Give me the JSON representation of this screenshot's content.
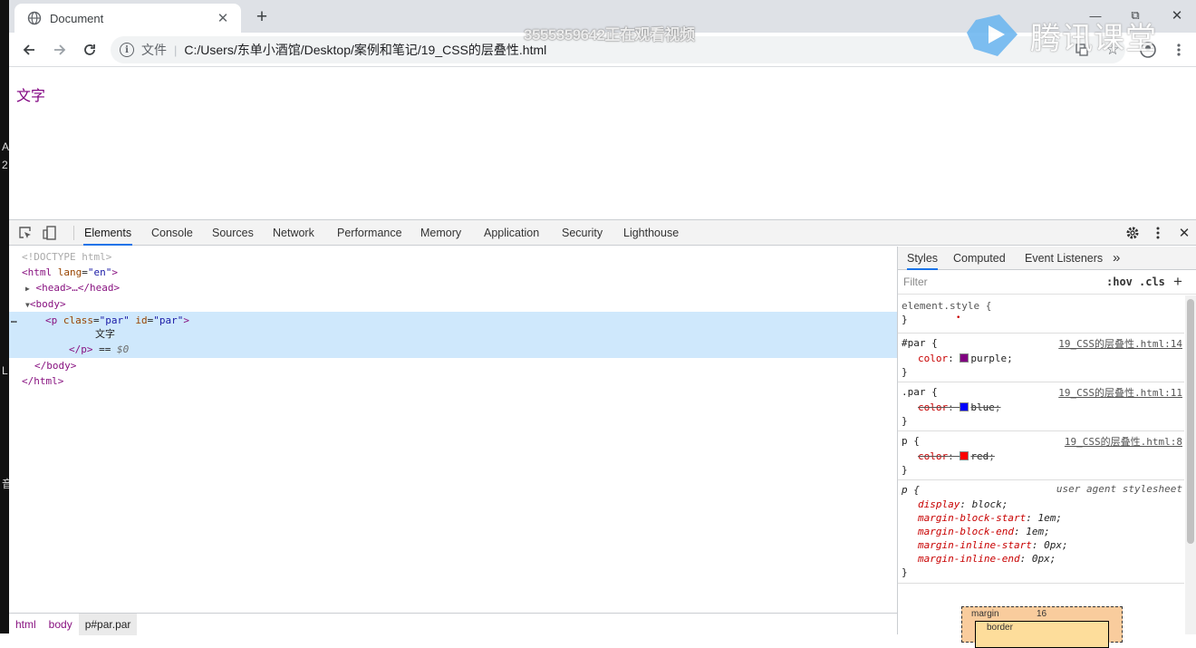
{
  "tab": {
    "title": "Document",
    "close": "✕",
    "new_tab": "+"
  },
  "window": {
    "minimize": "—",
    "restore": "⧉",
    "close": "✕"
  },
  "omnibox": {
    "scheme_label": "文件",
    "separator": "|",
    "url": "C:/Users/东单小酒馆/Desktop/案例和笔记/19_CSS的层叠性.html"
  },
  "overlay": {
    "viewer_text": "3555359642正在观看视频",
    "brand": "腾讯课堂"
  },
  "page": {
    "paragraph_text": "文字",
    "paragraph_color": "#800080"
  },
  "devtools": {
    "tabs": [
      "Elements",
      "Console",
      "Sources",
      "Network",
      "Performance",
      "Memory",
      "Application",
      "Security",
      "Lighthouse"
    ],
    "active_tab": "Elements",
    "dom": {
      "doctype": "<!DOCTYPE html>",
      "html_open_tag": "html",
      "html_attr": "lang",
      "html_attr_val": "\"en\"",
      "head_collapsed": "<head>…</head>",
      "body_open": "<body>",
      "ellipsis": "…",
      "p_tag": "p",
      "p_class_attr": "class",
      "p_class_val": "\"par\"",
      "p_id_attr": "id",
      "p_id_val": "\"par\"",
      "p_text": "文字",
      "p_close": "</p>",
      "p_eq": " == ",
      "p_sel": "$0",
      "body_close": "</body>",
      "html_close": "</html>"
    },
    "breadcrumbs": [
      "html",
      "body",
      "p#par.par"
    ],
    "styles": {
      "tabs": [
        "Styles",
        "Computed",
        "Event Listeners"
      ],
      "more": "»",
      "filter_placeholder": "Filter",
      "hov": ":hov",
      "cls": ".cls",
      "add": "+",
      "rules": [
        {
          "selector": "element.style {",
          "close": "}"
        },
        {
          "selector": "#par",
          "source": "19_CSS的层叠性.html:14",
          "prop": "color",
          "value": "purple",
          "swatch": "#800080",
          "overridden": false
        },
        {
          "selector": ".par",
          "source": "19_CSS的层叠性.html:11",
          "prop": "color",
          "value": "blue",
          "swatch": "#0000ff",
          "overridden": true
        },
        {
          "selector": "p",
          "source": "19_CSS的层叠性.html:8",
          "prop": "color",
          "value": "red",
          "swatch": "#ff0000",
          "overridden": true
        },
        {
          "selector": "p",
          "source": "user agent stylesheet",
          "props": [
            {
              "name": "display",
              "value": "block"
            },
            {
              "name": "margin-block-start",
              "value": "1em"
            },
            {
              "name": "margin-block-end",
              "value": "1em"
            },
            {
              "name": "margin-inline-start",
              "value": "0px"
            },
            {
              "name": "margin-inline-end",
              "value": "0px"
            }
          ]
        }
      ],
      "box_model": {
        "margin_label": "margin",
        "margin_value": "16",
        "border_label": "border"
      }
    }
  }
}
